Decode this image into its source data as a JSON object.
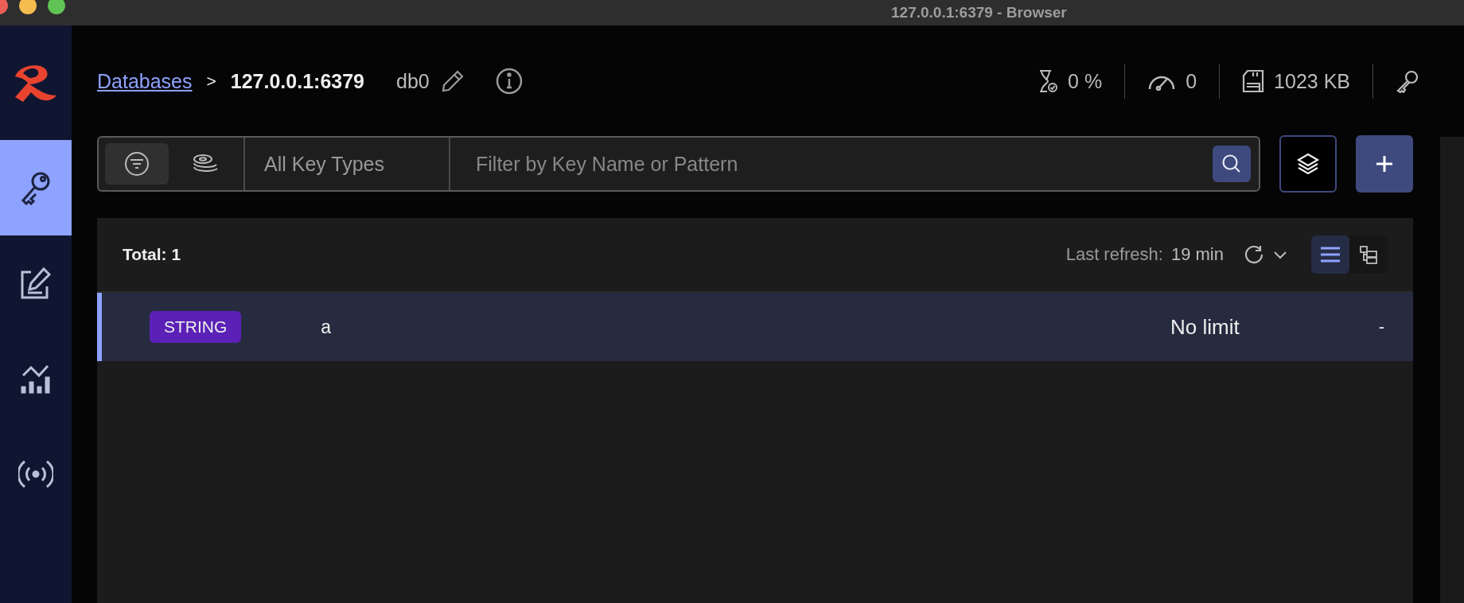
{
  "window": {
    "title": "127.0.0.1:6379 - Browser"
  },
  "sidebar": {
    "items": [
      {
        "kind": "browser",
        "selected": true
      },
      {
        "kind": "workbench",
        "selected": false
      },
      {
        "kind": "analytics",
        "selected": false
      },
      {
        "kind": "pubsub",
        "selected": false
      }
    ]
  },
  "breadcrumb": {
    "link": "Databases",
    "separator": ">",
    "current": "127.0.0.1:6379",
    "db": "db0"
  },
  "stats": [
    {
      "kind": "cpu",
      "value": "0 %"
    },
    {
      "kind": "ops",
      "value": "0"
    },
    {
      "kind": "memory",
      "value": "1023 KB"
    },
    {
      "kind": "keys"
    }
  ],
  "filter": {
    "modes": [
      {
        "kind": "filter",
        "selected": true
      },
      {
        "kind": "stack",
        "selected": false
      }
    ],
    "key_type": "All Key Types",
    "search": {
      "placeholder": "Filter by Key Name or Pattern"
    }
  },
  "list": {
    "total": "Total: 1",
    "refresh_label": "Last refresh:",
    "refresh_value": "19 min",
    "views": [
      {
        "kind": "list",
        "selected": true
      },
      {
        "kind": "tree",
        "selected": false
      }
    ],
    "rows": [
      {
        "type": "STRING",
        "color": "#5b21b6",
        "name": "a",
        "ttl": "No limit",
        "size": "-",
        "selected": true
      }
    ]
  }
}
